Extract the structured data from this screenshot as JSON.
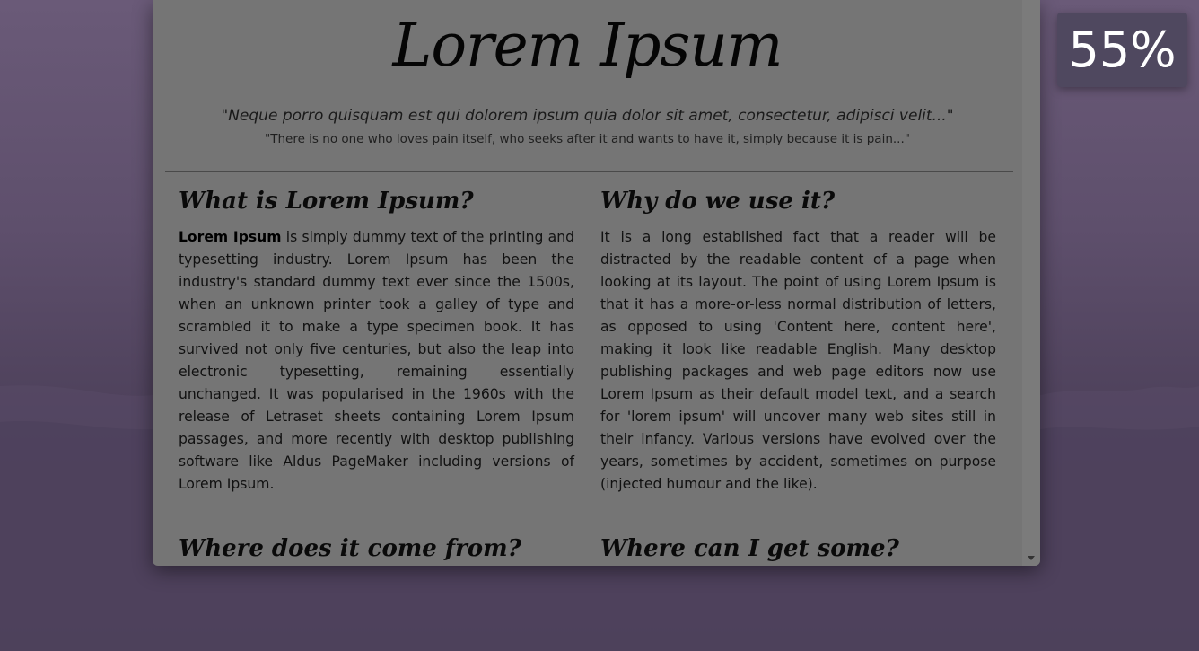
{
  "zoom": {
    "label": "55%"
  },
  "document": {
    "title": "Lorem Ipsum",
    "quote_latin": "\"Neque porro quisquam est qui dolorem ipsum quia dolor sit amet, consectetur, adipisci velit...\"",
    "quote_english": "\"There is no one who loves pain itself, who seeks after it and wants to have it, simply because it is pain...\"",
    "sections": {
      "what": {
        "heading": "What is Lorem Ipsum?",
        "lead": "Lorem Ipsum",
        "body": " is simply dummy text of the printing and typesetting industry. Lorem Ipsum has been the industry's standard dummy text ever since the 1500s, when an unknown printer took a galley of type and scrambled it to make a type specimen book. It has survived not only five centuries, but also the leap into electronic typesetting, remaining essentially unchanged. It was popularised in the 1960s with the release of Letraset sheets containing Lorem Ipsum passages, and more recently with desktop publishing software like Aldus PageMaker including versions of Lorem Ipsum."
      },
      "why": {
        "heading": "Why do we use it?",
        "body": "It is a long established fact that a reader will be distracted by the readable content of a page when looking at its layout. The point of using Lorem Ipsum is that it has a more-or-less normal distribution of letters, as opposed to using 'Content here, content here', making it look like readable English. Many desktop publishing packages and web page editors now use Lorem Ipsum as their default model text, and a search for 'lorem ipsum' will uncover many web sites still in their infancy. Various versions have evolved over the years, sometimes by accident, sometimes on purpose (injected humour and the like)."
      },
      "where_from": {
        "heading": "Where does it come from?"
      },
      "where_get": {
        "heading": "Where can I get some?"
      }
    }
  }
}
